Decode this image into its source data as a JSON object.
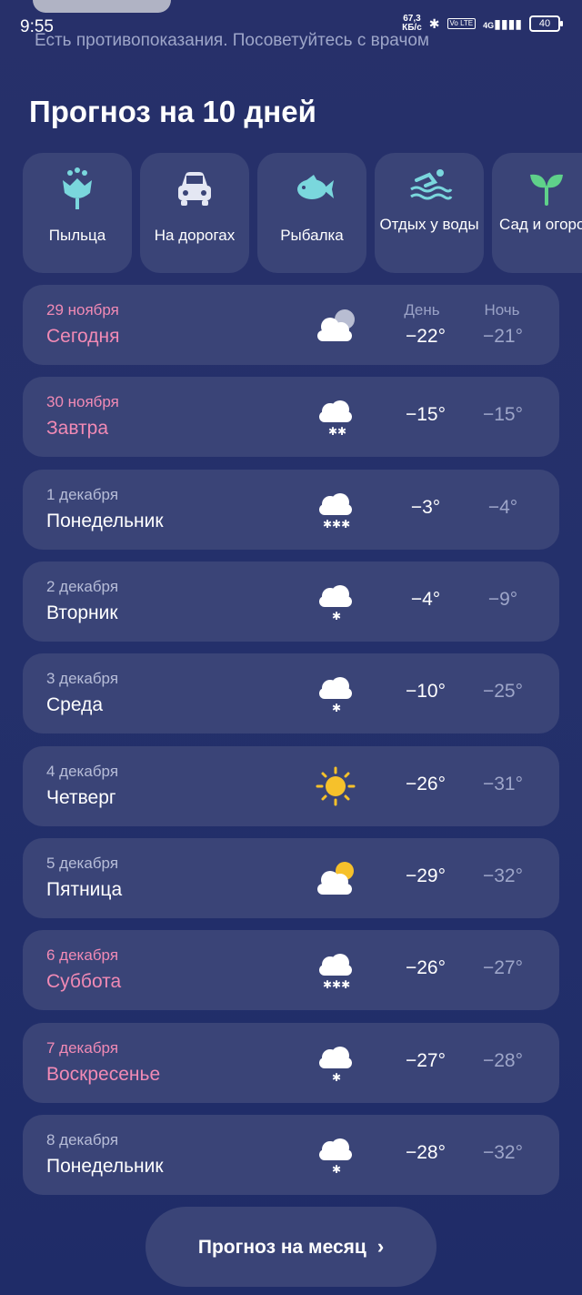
{
  "status_bar": {
    "time": "9:55",
    "net_speed_value": "67,3",
    "net_speed_unit": "КБ/с",
    "network": "4G",
    "volte": "Vo LTE",
    "battery": "40"
  },
  "notice": "Есть противопоказания. Посоветуйтесь с врачом",
  "title": "Прогноз на 10 дней",
  "categories": [
    {
      "label": "Пыльца",
      "icon": "flower-icon"
    },
    {
      "label": "На дорогах",
      "icon": "car-icon"
    },
    {
      "label": "Рыбалка",
      "icon": "fish-icon"
    },
    {
      "label": "Отдых у воды",
      "icon": "swimmer-icon"
    },
    {
      "label": "Сад и огород",
      "icon": "sprout-icon"
    }
  ],
  "headers": {
    "day": "День",
    "night": "Ночь"
  },
  "forecast": [
    {
      "date": "29 ноября",
      "day": "Сегодня",
      "icon": "cloudy-icon",
      "t_day": "−22°",
      "t_night": "−21°",
      "highlight": true
    },
    {
      "date": "30 ноября",
      "day": "Завтра",
      "icon": "snow-icon",
      "t_day": "−15°",
      "t_night": "−15°",
      "highlight": true
    },
    {
      "date": "1 декабря",
      "day": "Понедельник",
      "icon": "heavy-snow-icon",
      "t_day": "−3°",
      "t_night": "−4°",
      "highlight": false
    },
    {
      "date": "2 декабря",
      "day": "Вторник",
      "icon": "light-snow-icon",
      "t_day": "−4°",
      "t_night": "−9°",
      "highlight": false
    },
    {
      "date": "3 декабря",
      "day": "Среда",
      "icon": "light-snow-icon",
      "t_day": "−10°",
      "t_night": "−25°",
      "highlight": false
    },
    {
      "date": "4 декабря",
      "day": "Четверг",
      "icon": "sun-icon",
      "t_day": "−26°",
      "t_night": "−31°",
      "highlight": false
    },
    {
      "date": "5 декабря",
      "day": "Пятница",
      "icon": "partly-cloudy-icon",
      "t_day": "−29°",
      "t_night": "−32°",
      "highlight": false
    },
    {
      "date": "6 декабря",
      "day": "Суббота",
      "icon": "heavy-snow-icon",
      "t_day": "−26°",
      "t_night": "−27°",
      "highlight": true
    },
    {
      "date": "7 декабря",
      "day": "Воскресенье",
      "icon": "light-snow-icon",
      "t_day": "−27°",
      "t_night": "−28°",
      "highlight": true
    },
    {
      "date": "8 декабря",
      "day": "Понедельник",
      "icon": "light-snow-icon",
      "t_day": "−28°",
      "t_night": "−32°",
      "highlight": false
    }
  ],
  "month_button": "Прогноз на месяц",
  "colors": {
    "background": "#24306b",
    "card": "#3a4477",
    "weekend_text": "#f18ab5",
    "accent_green": "#5fd18a",
    "accent_teal": "#7ad7dd",
    "sun": "#f6c12b"
  }
}
